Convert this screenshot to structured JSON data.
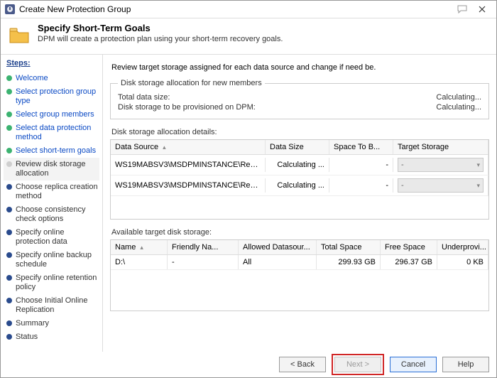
{
  "window": {
    "title": "Create New Protection Group"
  },
  "header": {
    "title": "Specify Short-Term Goals",
    "subtitle": "DPM will create a protection plan using your short-term recovery goals."
  },
  "sidebar": {
    "section": "Steps:",
    "items": [
      {
        "label": "Welcome",
        "state": "done"
      },
      {
        "label": "Select protection group type",
        "state": "done"
      },
      {
        "label": "Select group members",
        "state": "done"
      },
      {
        "label": "Select data protection method",
        "state": "done"
      },
      {
        "label": "Select short-term goals",
        "state": "done"
      },
      {
        "label": "Review disk storage allocation",
        "state": "cur"
      },
      {
        "label": "Choose replica creation method",
        "state": "todo"
      },
      {
        "label": "Choose consistency check options",
        "state": "todo"
      },
      {
        "label": "Specify online protection data",
        "state": "todo"
      },
      {
        "label": "Specify online backup schedule",
        "state": "todo"
      },
      {
        "label": "Specify online retention policy",
        "state": "todo"
      },
      {
        "label": "Choose Initial Online Replication",
        "state": "todo"
      },
      {
        "label": "Summary",
        "state": "todo"
      },
      {
        "label": "Status",
        "state": "todo"
      }
    ]
  },
  "main": {
    "instruction": "Review target storage assigned for each data source and change if need be.",
    "alloc_box": {
      "legend": "Disk storage allocation for new members",
      "rows": [
        {
          "k": "Total data size:",
          "v": "Calculating..."
        },
        {
          "k": "Disk storage to be provisioned on DPM:",
          "v": "Calculating..."
        }
      ]
    },
    "details": {
      "label": "Disk storage allocation details:",
      "headers": {
        "c1": "Data Source",
        "c2": "Data Size",
        "c3": "Space To B...",
        "c4": "Target Storage"
      },
      "rows": [
        {
          "ds": "WS19MABSV3\\MSDPMINSTANCE\\ReportServe...",
          "size": "Calculating ...",
          "space": "-",
          "target": "-"
        },
        {
          "ds": "WS19MABSV3\\MSDPMINSTANCE\\ReportServe...",
          "size": "Calculating ...",
          "space": "-",
          "target": "-"
        }
      ]
    },
    "avail": {
      "label": "Available target disk storage:",
      "headers": {
        "c1": "Name",
        "c2": "Friendly Na...",
        "c3": "Allowed Datasour...",
        "c4": "Total Space",
        "c5": "Free Space",
        "c6": "Underprovi..."
      },
      "rows": [
        {
          "name": "D:\\",
          "friendly": "-",
          "allowed": "All",
          "total": "299.93 GB",
          "free": "296.37 GB",
          "under": "0 KB"
        }
      ]
    }
  },
  "footer": {
    "back": "< Back",
    "next": "Next >",
    "cancel": "Cancel",
    "help": "Help"
  }
}
